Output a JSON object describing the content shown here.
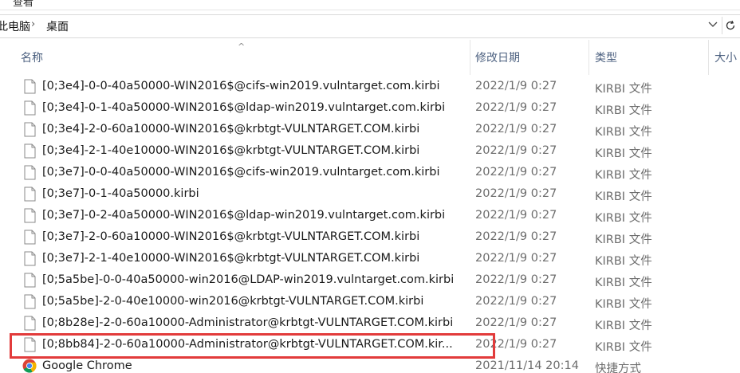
{
  "ribbon": {
    "label": "查看"
  },
  "address": {
    "crumbs": [
      "此电脑",
      "桌面"
    ],
    "separator": "›",
    "dropdown_icon": "chevron-down-icon",
    "refresh_icon": "refresh-icon"
  },
  "columns": {
    "name": "名称",
    "date": "修改日期",
    "type": "类型",
    "size": "大小",
    "sort_indicator": "^"
  },
  "files": [
    {
      "name": "[0;3e4]-0-0-40a50000-WIN2016$@cifs-win2019.vulntarget.com.kirbi",
      "date": "2022/1/9 0:27",
      "type": "KIRBI 文件",
      "icon": "file-icon"
    },
    {
      "name": "[0;3e4]-0-1-40a50000-WIN2016$@ldap-win2019.vulntarget.com.kirbi",
      "date": "2022/1/9 0:27",
      "type": "KIRBI 文件",
      "icon": "file-icon"
    },
    {
      "name": "[0;3e4]-2-0-60a10000-WIN2016$@krbtgt-VULNTARGET.COM.kirbi",
      "date": "2022/1/9 0:27",
      "type": "KIRBI 文件",
      "icon": "file-icon"
    },
    {
      "name": "[0;3e4]-2-1-40e10000-WIN2016$@krbtgt-VULNTARGET.COM.kirbi",
      "date": "2022/1/9 0:27",
      "type": "KIRBI 文件",
      "icon": "file-icon"
    },
    {
      "name": "[0;3e7]-0-0-40a50000-WIN2016$@cifs-win2019.vulntarget.com.kirbi",
      "date": "2022/1/9 0:27",
      "type": "KIRBI 文件",
      "icon": "file-icon"
    },
    {
      "name": "[0;3e7]-0-1-40a50000.kirbi",
      "date": "2022/1/9 0:27",
      "type": "KIRBI 文件",
      "icon": "file-icon"
    },
    {
      "name": "[0;3e7]-0-2-40a50000-WIN2016$@ldap-win2019.vulntarget.com.kirbi",
      "date": "2022/1/9 0:27",
      "type": "KIRBI 文件",
      "icon": "file-icon"
    },
    {
      "name": "[0;3e7]-2-0-60a10000-WIN2016$@krbtgt-VULNTARGET.COM.kirbi",
      "date": "2022/1/9 0:27",
      "type": "KIRBI 文件",
      "icon": "file-icon"
    },
    {
      "name": "[0;3e7]-2-1-40e10000-WIN2016$@krbtgt-VULNTARGET.COM.kirbi",
      "date": "2022/1/9 0:27",
      "type": "KIRBI 文件",
      "icon": "file-icon"
    },
    {
      "name": "[0;5a5be]-0-0-40a50000-win2016@LDAP-win2019.vulntarget.com.kirbi",
      "date": "2022/1/9 0:27",
      "type": "KIRBI 文件",
      "icon": "file-icon"
    },
    {
      "name": "[0;5a5be]-2-0-40e10000-win2016@krbtgt-VULNTARGET.COM.kirbi",
      "date": "2022/1/9 0:27",
      "type": "KIRBI 文件",
      "icon": "file-icon"
    },
    {
      "name": "[0;8b28e]-2-0-60a10000-Administrator@krbtgt-VULNTARGET.COM.kirbi",
      "date": "2022/1/9 0:27",
      "type": "KIRBI 文件",
      "icon": "file-icon"
    },
    {
      "name": "[0;8bb84]-2-0-60a10000-Administrator@krbtgt-VULNTARGET.COM.kir...",
      "date": "2022/1/9 0:27",
      "type": "KIRBI 文件",
      "icon": "file-icon",
      "highlighted": true
    },
    {
      "name": "Google Chrome",
      "date": "2021/11/14 20:14",
      "type": "快捷方式",
      "icon": "chrome-icon"
    }
  ],
  "colors": {
    "highlight": "#e23b3b",
    "header_text": "#4d6180",
    "meta_text": "#6d6d6d"
  }
}
